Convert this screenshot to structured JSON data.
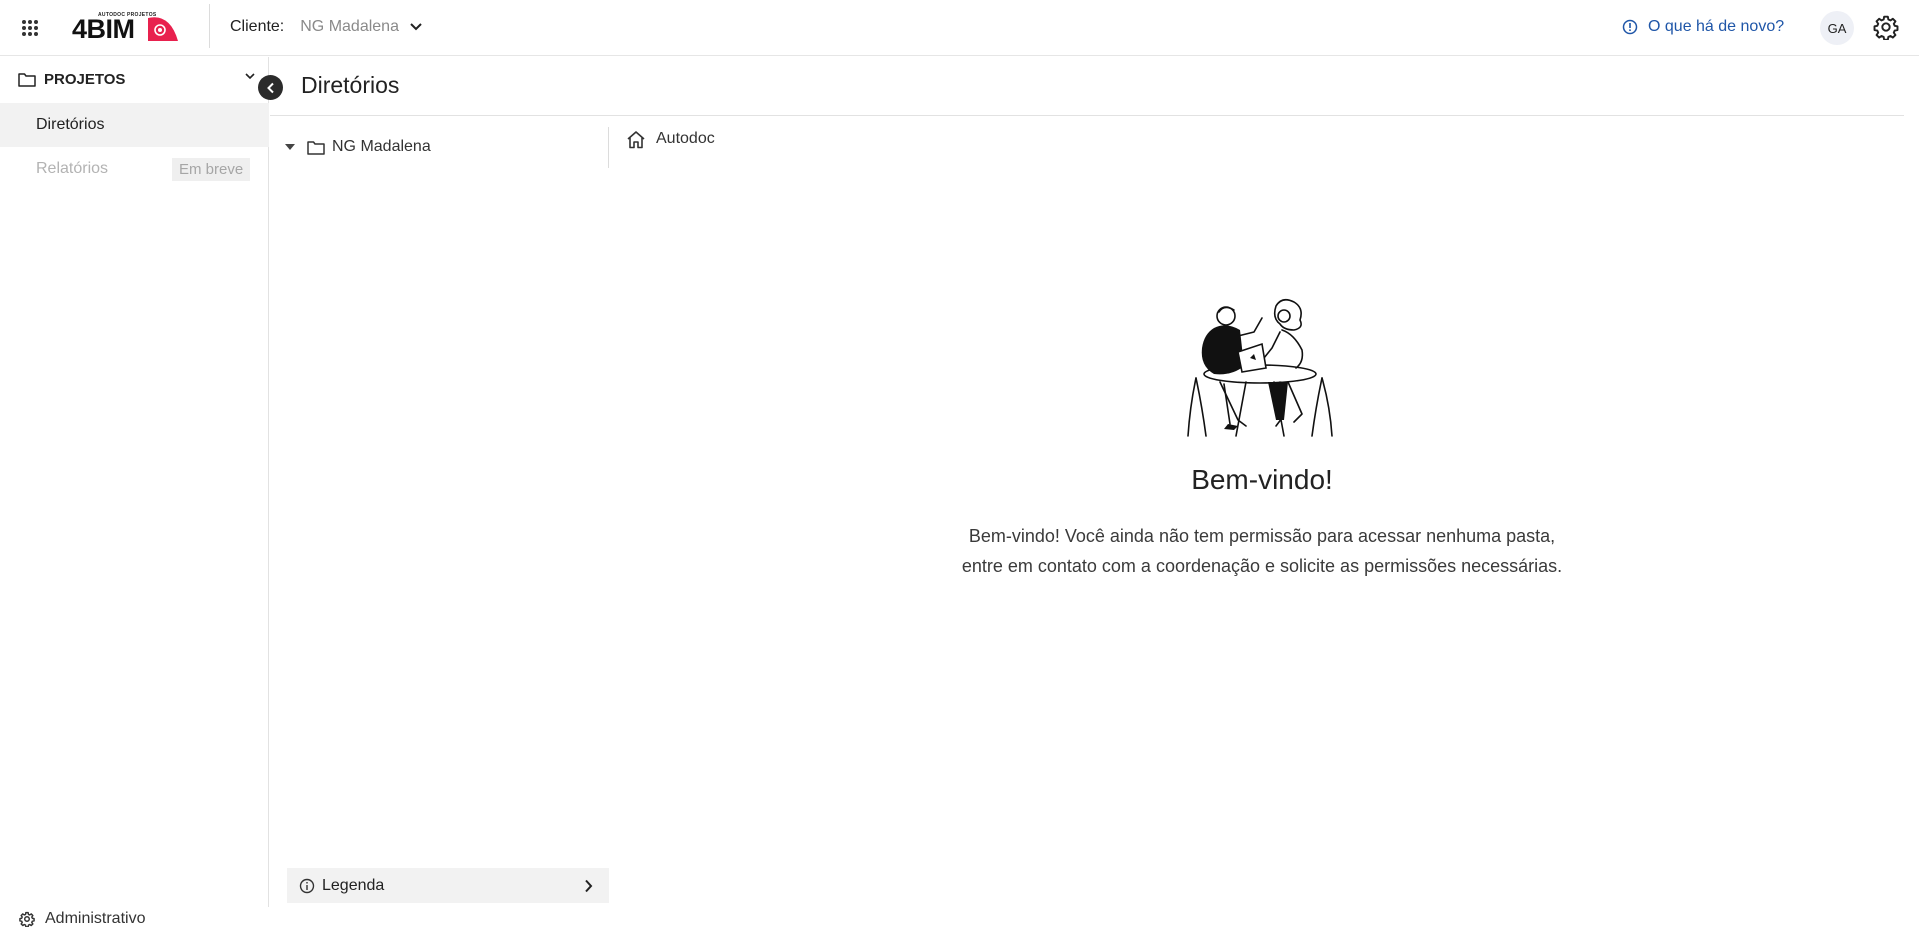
{
  "header": {
    "logo_brand": "4BIM",
    "logo_small": "AUTODOC PROJETOS",
    "client_label": "Cliente:",
    "client_value": "NG Madalena",
    "whats_new": "O que há de novo?",
    "avatar_initials": "GA"
  },
  "sidebar": {
    "section_label": "PROJETOS",
    "items": [
      {
        "label": "Diretórios",
        "active": true
      },
      {
        "label": "Relatórios",
        "badge": "Em breve",
        "disabled": true
      }
    ],
    "footer_label": "Administrativo"
  },
  "main": {
    "title": "Diretórios",
    "tree_root": "NG Madalena",
    "breadcrumb_home": "Autodoc",
    "welcome_title": "Bem-vindo!",
    "welcome_text": "Bem-vindo! Você ainda não tem permissão para acessar nenhuma pasta, entre em contato com a coordenação e solicite as permissões necessárias.",
    "legend_label": "Legenda"
  },
  "icons": {
    "apps": "apps-grid-icon",
    "chevron": "chevron-down-icon",
    "info": "info-icon",
    "settings": "gear-icon",
    "folder": "folder-icon",
    "home": "home-icon",
    "collapse": "chevron-left-icon"
  },
  "colors": {
    "accent_link": "#1f56a8",
    "logo_red": "#e8214e",
    "active_bg": "#f2f2f2"
  }
}
